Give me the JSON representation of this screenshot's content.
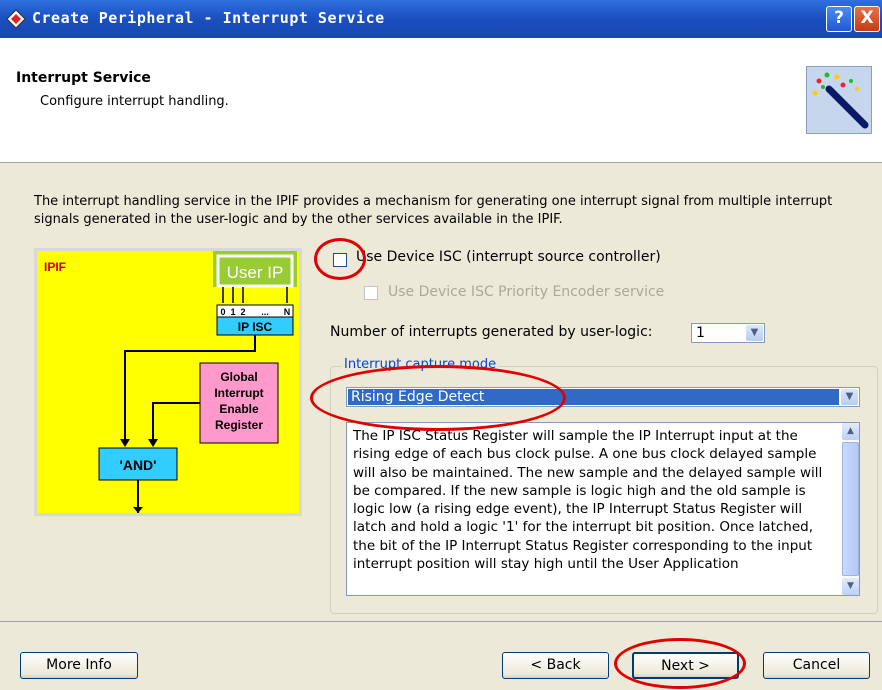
{
  "window": {
    "title": "Create Peripheral - Interrupt Service",
    "help_label": "?",
    "close_label": "X"
  },
  "header": {
    "title": "Interrupt Service",
    "subtitle": "Configure interrupt handling."
  },
  "intro_text": "The interrupt handling service in the IPIF provides a mechanism for generating one interrupt signal from multiple interrupt signals generated in the user-logic and by the other services available in the IPIF.",
  "diagram": {
    "ipif_label": "IPIF",
    "user_ip": "User IP",
    "bits": [
      "0",
      "1",
      "2",
      "...",
      "N"
    ],
    "ip_isc": "IP ISC",
    "global_interrupt": [
      "Global",
      "Interrupt",
      "Enable",
      "Register"
    ],
    "and_gate": "'AND'"
  },
  "options": {
    "use_isc_label": "Use Device ISC (interrupt source controller)",
    "use_isc_checked": false,
    "priority_encoder_label": "Use Device ISC Priority Encoder service",
    "priority_encoder_enabled": false,
    "num_interrupts_label": "Number of interrupts generated by user-logic:",
    "num_interrupts_value": "1"
  },
  "capture_mode": {
    "group_label": "Interrupt capture mode",
    "selected": "Rising Edge Detect",
    "description": "The IP ISC Status Register will sample the IP Interrupt input at the rising edge of each bus clock pulse. A one bus clock delayed sample will also be maintained. The new sample and the delayed sample will be compared. If the new sample is logic high and the old sample is logic low (a rising edge event), the IP Interrupt Status Register will latch and hold a logic '1' for the interrupt bit position. Once latched, the bit of the IP Interrupt Status Register corresponding to the input interrupt position will stay high until the User Application"
  },
  "footer": {
    "more_info": "More Info",
    "back": "< Back",
    "next": "Next >",
    "cancel": "Cancel"
  },
  "colors": {
    "titlebar": "#1a4fbf",
    "selection": "#316ac5",
    "annotation": "#e00000",
    "diagram_bg": "#ffff00"
  },
  "icons": [
    "app-icon",
    "wizard-wand-icon",
    "chevron-down-icon",
    "scroll-up-icon",
    "scroll-down-icon"
  ]
}
